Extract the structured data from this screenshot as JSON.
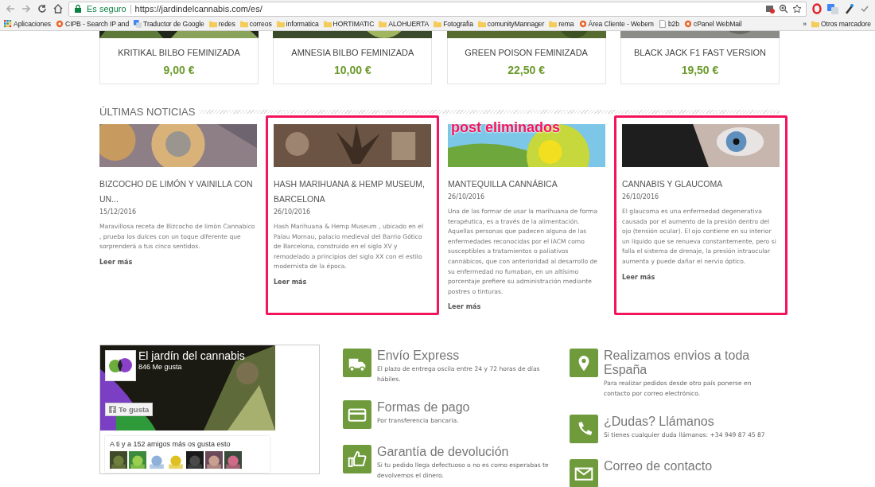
{
  "browser": {
    "security": "Es seguro",
    "url": "https://jardindelcannabis.com/es/"
  },
  "bookmarks": [
    {
      "label": "Aplicaciones",
      "kind": "apps"
    },
    {
      "label": "CIPB - Search IP and",
      "kind": "site"
    },
    {
      "label": "Traductor de Google",
      "kind": "translate"
    },
    {
      "label": "redes",
      "kind": "folder"
    },
    {
      "label": "correos",
      "kind": "folder"
    },
    {
      "label": "informatica",
      "kind": "folder"
    },
    {
      "label": "HORTIMATIC",
      "kind": "folder"
    },
    {
      "label": "ALOHUERTA",
      "kind": "folder"
    },
    {
      "label": "Fotografia",
      "kind": "folder"
    },
    {
      "label": "comunityMannager",
      "kind": "folder"
    },
    {
      "label": "rema",
      "kind": "folder"
    },
    {
      "label": "Área Cliente - Webem",
      "kind": "site"
    },
    {
      "label": "b2b",
      "kind": "page"
    },
    {
      "label": "cPanel WebMail",
      "kind": "site"
    }
  ],
  "bookmarks_more": "»",
  "other_bookmarks": "Otros marcadore",
  "products": [
    {
      "name": "KRITIKAL BILBO FEMINIZADA",
      "price": "9,00 €"
    },
    {
      "name": "AMNESIA BILBO FEMINIZADA",
      "price": "10,00 €"
    },
    {
      "name": "GREEN POISON FEMINIZADA",
      "price": "22,50 €"
    },
    {
      "name": "BLACK JACK F1 FAST VERSION",
      "price": "19,50 €"
    }
  ],
  "news": {
    "heading": "ÚLTIMAS NOTICIAS",
    "annotation": "post eliminados",
    "posts": [
      {
        "title": "BIZCOCHO DE LIMÓN Y VAINILLA CON UN...",
        "date": "15/12/2016",
        "excerpt": "Maravillosa receta de Bizcocho de limón Cannabico , prueba los dulces con un toque diferente que sorprenderá a tus cinco sentidos.",
        "link": "Leer más",
        "highlighted": false
      },
      {
        "title": "HASH MARIHUANA & HEMP MUSEUM, BARCELONA",
        "date": "26/10/2016",
        "excerpt": "Hash Marihuana & Hemp Museum , ubicado en el Palau Mornau, palacio medieval del Barrio Gótico de Barcelona, construido en el siglo XV y remodelado a principios del siglo XX con el estilo modernista de la época.",
        "link": "Leer más",
        "highlighted": true
      },
      {
        "title": "MANTEQUILLA CANNÁBICA",
        "date": "26/10/2016",
        "excerpt": "Una de las formar de usar la marihuana de forma terapéutica, es a través de la alimentación. Aquellas personas que padecen alguna de las enfermedades reconocidas por el IACM como susceptibles a tratamientos o paliativos cannábicos, que con anterioridad al desarrollo de su enfermedad no fumaban, en un altísimo porcentaje prefiere su administración mediante postres o tinturas.",
        "link": "Leer más",
        "highlighted": false
      },
      {
        "title": "CANNABIS Y GLAUCOMA",
        "date": "26/10/2016",
        "excerpt": "El glaucoma es una enfermedad degenerativa causada por el aumento de la presión dentro del ojo (tensión ocular). El ojo contiene en su interior un líquido que se renueva constantemente, pero si falla el sistema de drenaje, la presión intraocular aumenta y puede dañar el nervio óptico.",
        "link": "Leer más",
        "highlighted": true
      }
    ]
  },
  "facebook": {
    "page_name": "El jardín del cannabis",
    "likes": "846 Me gusta",
    "like_button": "Te gusta",
    "friends": "A ti y a 152 amigos más os gusta esto"
  },
  "features": [
    [
      {
        "kind": "truck",
        "title": "Envío Express",
        "text": "El plazo de entrega oscila entre 24 y 72 horas de días hábiles."
      },
      {
        "kind": "card",
        "title": "Formas de pago",
        "text": "Por transferencia bancaria."
      },
      {
        "kind": "thumb",
        "title": "Garantía de devolución",
        "text": "Si tu pedido llega defectuoso o no es como esperabas te devolvemos el dinero."
      }
    ],
    [
      {
        "kind": "pin",
        "title": "Realizamos envios a toda España",
        "text": "Para realizar pedidos desde otro país ponerse en contacto por correo electrónico."
      },
      {
        "kind": "phone",
        "title": "¿Dudas? Llámanos",
        "text": "Si tienes cualquier duda llámanos: +34 949 87 45 87"
      },
      {
        "kind": "mail",
        "title": "Correo de contacto"
      }
    ]
  ]
}
